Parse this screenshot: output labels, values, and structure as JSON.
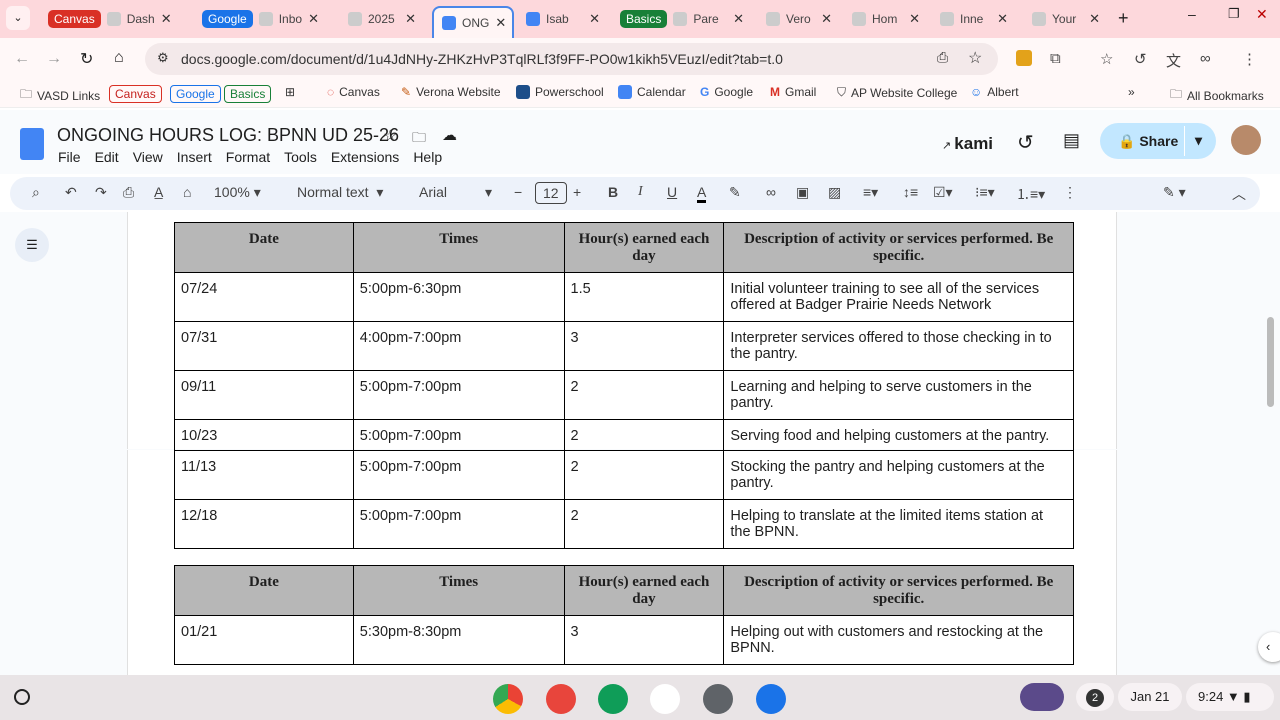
{
  "tabs": [
    {
      "group": "Canvas",
      "group_color": "#d93025",
      "label": "Dash",
      "icon": "canvas-icon"
    },
    {
      "group": "Google",
      "group_color": "#1a73e8",
      "label": "Inbo",
      "icon": "gmail-icon"
    },
    {
      "label": "2025",
      "icon": "drive-icon"
    },
    {
      "label": "ONG",
      "icon": "docs-icon",
      "active": true
    },
    {
      "label": "Isab",
      "icon": "docs-icon"
    },
    {
      "group": "Basics",
      "group_color": "#188038",
      "label": "Pare",
      "icon": "sis-icon"
    },
    {
      "label": "Vero",
      "icon": "calendar-icon"
    },
    {
      "label": "Hom",
      "icon": "verona-icon"
    },
    {
      "label": "Inne",
      "icon": "app-icon"
    },
    {
      "label": "Your",
      "icon": "app-icon"
    }
  ],
  "url": "docs.google.com/document/d/1u4JdNHy-ZHKzHvP3TqlRLf3f9FF-PO0w1kikh5VEuzI/edit?tab=t.0",
  "bookmarks": [
    "VASD Links",
    "Canvas",
    "Google",
    "Basics",
    "Canvas",
    "Verona Website",
    "Powerschool",
    "Calendar",
    "Google",
    "Gmail",
    "AP Website College",
    "Albert",
    "All Bookmarks"
  ],
  "doc": {
    "title": "ONGOING HOURS LOG: BPNN UD 25-26",
    "menu": [
      "File",
      "Edit",
      "View",
      "Insert",
      "Format",
      "Tools",
      "Extensions",
      "Help"
    ],
    "kami": "kami",
    "share": "Share"
  },
  "toolbar": {
    "zoom": "100%",
    "style": "Normal text",
    "font": "Arial",
    "size": "12"
  },
  "table": {
    "headers": [
      "Date",
      "Times",
      "Hour(s) earned each day",
      "Description of activity or services performed. Be specific."
    ],
    "rows1": [
      [
        "07/24",
        "5:00pm-6:30pm",
        "1.5",
        "Initial volunteer training to see all of the services offered at Badger Prairie Needs Network"
      ],
      [
        "07/31",
        "4:00pm-7:00pm",
        "3",
        "Interpreter services offered to those checking in to the pantry."
      ],
      [
        "09/11",
        "5:00pm-7:00pm",
        "2",
        "Learning and helping to serve customers in the pantry."
      ],
      [
        "10/23",
        "5:00pm-7:00pm",
        "2",
        "Serving food and helping customers at the pantry."
      ]
    ],
    "rows2": [
      [
        "11/13",
        "5:00pm-7:00pm",
        "2",
        "Stocking the pantry and helping customers at the pantry."
      ],
      [
        "12/18",
        "5:00pm-7:00pm",
        "2",
        "Helping to translate at the limited items station at the BPNN."
      ]
    ],
    "rows3": [
      [
        "01/21",
        "5:30pm-8:30pm",
        "3",
        "Helping out with customers and restocking at the BPNN."
      ]
    ]
  },
  "taskbar": {
    "notifications": "2",
    "date": "Jan 21",
    "time": "9:24"
  }
}
